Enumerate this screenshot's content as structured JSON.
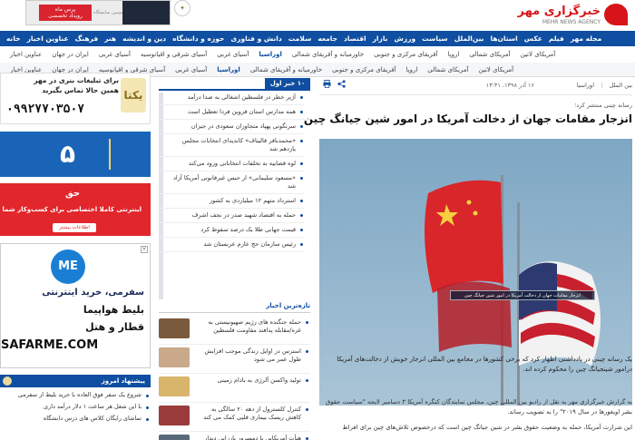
{
  "header": {
    "logo_text": "خبرگزاری مهر",
    "logo_sub": "MEHR NEWS AGENCY",
    "top_ad": {
      "brand": "پرس ماه",
      "subtitle": "سومین نمایشگاه",
      "tagline": "رویداد تخصصی"
    }
  },
  "main_nav": [
    "خانه",
    "عناوین اخبار",
    "فرهنگ",
    "هنر",
    "دین و اندیشه",
    "حوزه و دانشگاه",
    "دانش و فناوری",
    "سلامت",
    "جامعه",
    "اقتصاد",
    "بازار",
    "ورزش",
    "سیاست",
    "بین‌الملل",
    "استان‌ها",
    "عکس",
    "فیلم",
    "مجله مهر"
  ],
  "sub_nav_1": {
    "items": [
      "عناوین اخبار",
      "ایران در جهان",
      "آسیای غربی",
      "آسیای شرقی و اقیانوسیه",
      "آسیای غربی",
      "اوراسیا",
      "خاورمیانه و آفریقای شمالی",
      "آفریقای مرکزی و جنوبی",
      "اروپا",
      "آمریکای شمالی",
      "آمریکای لاتین"
    ],
    "active": "اوراسیا"
  },
  "sub_nav_2": {
    "items": [
      "عناوین اخبار",
      "ایران در جهان",
      "آسیای شرقی و اقیانوسیه",
      "آسیای غربی",
      "اوراسیا",
      "خاورمیانه و آفریقای شمالی",
      "آفریقای مرکزی و جنوبی",
      "اروپا",
      "آمریکای شمالی",
      "آمریکای لاتین"
    ],
    "active": "اوراسیا"
  },
  "article": {
    "category": "بین الملل",
    "subcategory": "اوراسیا",
    "date": "۱۶ آذر ۱۳۹۸، ۱۳:۳۱",
    "rutitr": "رسانه چینی منتشر کرد؛",
    "headline": "انزجار مقامات جهان از دخالت آمریکا در امور شین جیانگ چین",
    "image_caption": "انزجار مقامات جهان از دخالت آمریکا در امور شین جیانگ چین",
    "lead": "یک رسانه چینی در یادداشتی اظهار کرد که برخی کشورها در مجامع بین المللی انزجار خویش از دخالت‌های آمریکا درامور شینجیانگ چین را محکوم کرده اند.",
    "body": "به گزارش خبرگزاری مهر به نقل از رادیو بین المللی چین، مجلس نمایندگان کنگره آمریکا ۳ دسامبر لایحه \"سیاست حقوق بشر اویغورها در سال ۲۰۱۹\" را به تصویب رساند.",
    "body2": "این شرارت آمریکا، حمله به وضعیت حقوق بشر در شین جیانگ چین است که درخصوص تلاش‌های چین برای افراط"
  },
  "most_viewed": {
    "tab_label": "۱۰ خبر اول",
    "items": [
      "آژیر خطر در فلسطین اشغالی به صدا درآمد",
      "همه مدارس استان قزوین فردا تعطیل است",
      "سرنگونی پهپاد متجاوزان سعودی در جیزان",
      "«محمدباقر قالیباف» کاندیدای انتخابات مجلس یازدهم شد",
      "لوه قضاییه به تخلفات انتخاباتی ورود می‌کند",
      "«مسعود سلیمانی» از حبس غیرقانونی آمریکا آزاد شد",
      "استرداد متهم ۱۲ میلیاردی به کشور",
      "حمله به اقتصاد شهید صدر در نجف اشرف",
      "قیمت جهانی طلا یک درصد سقوط کرد",
      "رئیس سازمان حج عازم عربستان شد"
    ]
  },
  "latest": {
    "title": "تازه‌ترین اخبار",
    "items": [
      "حمله جنگنده های رژیم صهیونیستی به غزه/مقابله پدافند مقاومت فلسطین",
      "استرس در اوایل زندگی موجب افزایش طول عمر می شود",
      "تولید واکسن آلرژی به بادام زمینی",
      "کنترل کلسترول از دهه ۲۰ سالگی به کاهش ریسک بیماری قلبی کمک می کند",
      "هیأت آمریکایی با دمسرور بارزانی دیدار کرد"
    ],
    "thumb_colors": [
      "#7a5a3c",
      "#c9a98a",
      "#d8b56a",
      "#9a3c3c",
      "#5a6a7a"
    ]
  },
  "ads": {
    "ad1": {
      "line1": "برای تبلیغات بنری در مهر",
      "line2": "همین حالا تماس بگیرید",
      "phone": "۰۹۹۲۷۷۰۳۵۰۷",
      "brand": "یکتا"
    },
    "ad2": {
      "number": "۵"
    },
    "ad3": {
      "logo": "حق",
      "line1": "اینترنتی کاملا اختصاصی برای کسب‌وکار شما",
      "button": "اطلاعات بیشتر"
    },
    "ad4": {
      "logo": "ME",
      "line1": "سفرمی، خرید اینترنتی",
      "line2": "بلیط هواپیما",
      "line3": "قطار و هتل",
      "url": "SAFARME.COM"
    }
  },
  "today_suggestion": {
    "title": "پیشنهاد امروز",
    "items": [
      "شروع یک سفر فوق العاده با خرید بلیط از سفرمی",
      "با این شغل هر ساعت ۱ دلار درآمد داری",
      "تماشای رایگان کلاس های درس دانشگاه"
    ]
  },
  "colors": {
    "brand_red": "#d7141a",
    "nav_blue": "#0f4ea0"
  }
}
